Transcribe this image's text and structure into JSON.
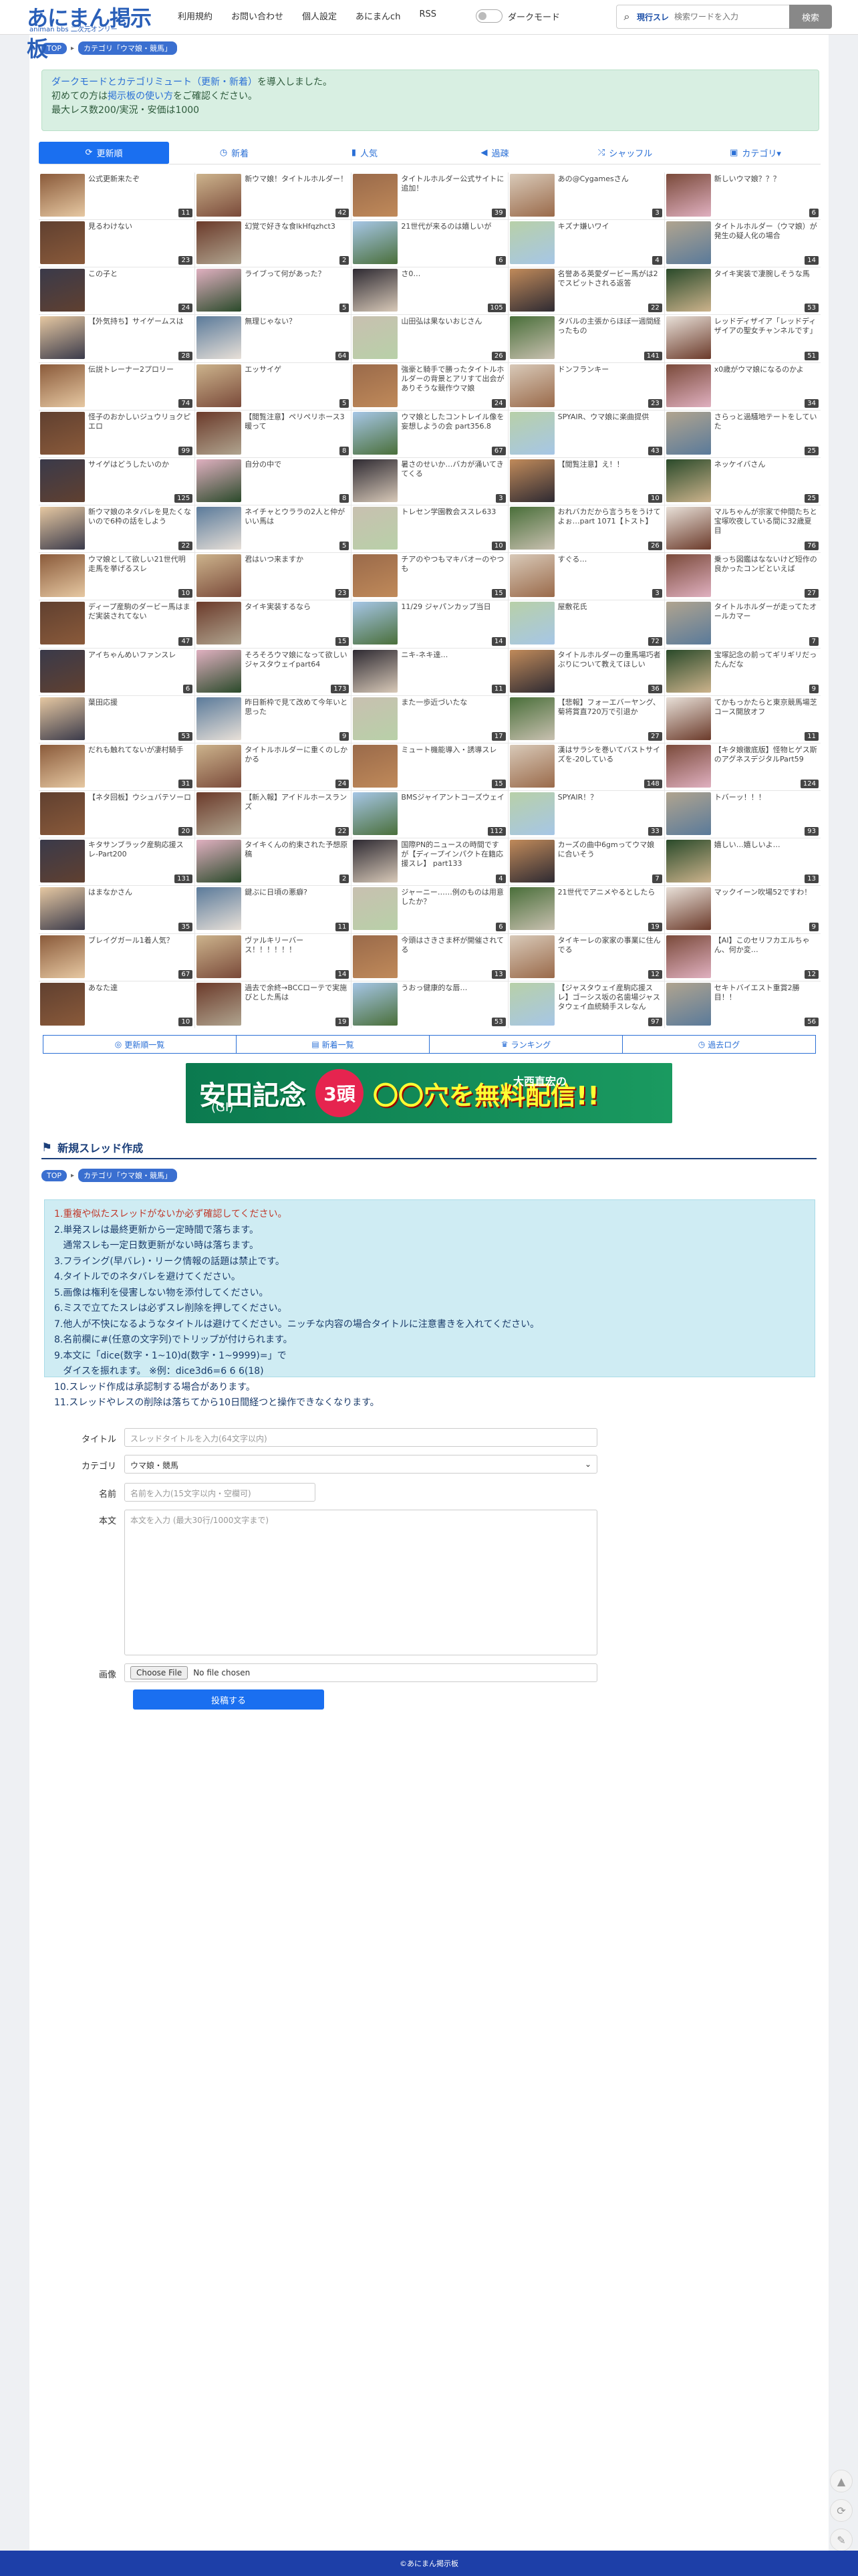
{
  "header": {
    "logo_main": "あにまん掲示板",
    "logo_sub": "animan bbs 二次元オンリー",
    "nav": [
      "利用規約",
      "お問い合わせ",
      "個人設定",
      "あにまんch",
      "RSS"
    ],
    "dark_mode_label": "ダークモード",
    "search_tag": "現行スレ",
    "search_placeholder": "検索ワードを入力",
    "search_button": "検索"
  },
  "breadcrumb": {
    "top": "TOP",
    "category": "カテゴリ「ウマ娘・競馬」"
  },
  "notice": {
    "line1_link": "ダークモードとカテゴリミュート（更新・新着）",
    "line1_text": "を導入しました。",
    "line2_pre": "初めての方は",
    "line2_link": "掲示板の使い方",
    "line2_post": "をご確認ください。",
    "line3": "最大レス数200/実況・安価は1000"
  },
  "tabs": [
    {
      "label": "更新順",
      "icon": "⟳"
    },
    {
      "label": "新着",
      "icon": "◷"
    },
    {
      "label": "人気",
      "icon": "▮"
    },
    {
      "label": "過疎",
      "icon": "◀"
    },
    {
      "label": "シャッフル",
      "icon": "⤮"
    },
    {
      "label": "カテゴリ▾",
      "icon": "▣"
    }
  ],
  "threads": [
    {
      "t": "公式更新来たぞ",
      "c": "11"
    },
    {
      "t": "新ウマ娘！タイトルホルダー！",
      "c": "42"
    },
    {
      "t": "タイトルホルダー公式サイトに追加！",
      "c": "39"
    },
    {
      "t": "あの@Cygamesさん",
      "c": "3"
    },
    {
      "t": "新しいウマ娘？？？",
      "c": "6"
    },
    {
      "t": "見るわけない",
      "c": "23"
    },
    {
      "t": "幻覚で好きな食lkHfqzhct3",
      "c": "2"
    },
    {
      "t": "21世代が来るのは嬉しいが",
      "c": "6"
    },
    {
      "t": "キズナ嫌いワイ",
      "c": "4"
    },
    {
      "t": "タイトルホルダー（ウマ娘）が発生の疑人化の場合",
      "c": "14"
    },
    {
      "t": "この子と",
      "c": "24"
    },
    {
      "t": "ライブって何があった？",
      "c": "5"
    },
    {
      "t": "さ0…",
      "c": "105"
    },
    {
      "t": "名誉ある英愛ダービー馬がは2でスピットされる返答",
      "c": "22"
    },
    {
      "t": "タイキ実装で凄腕しそうな馬",
      "c": "53"
    },
    {
      "t": "【外気持ち】サイゲームスは",
      "c": "28"
    },
    {
      "t": "無理じゃない？",
      "c": "64"
    },
    {
      "t": "山田弘は果ないおじさん",
      "c": "26"
    },
    {
      "t": "タバルの主張からほぼ一週間経ったもの",
      "c": "141"
    },
    {
      "t": "レッドディザイア「レッドディザイアの聖女チャンネルです」",
      "c": "51"
    },
    {
      "t": "伝説トレーナー2プロリー",
      "c": "74"
    },
    {
      "t": "エッサイゲ",
      "c": "5"
    },
    {
      "t": "強豪と騎手で勝ったタイトルホルダーの背景とアリすて出会がありそうな競作ウマ娘",
      "c": "24"
    },
    {
      "t": "ドンフランキー",
      "c": "23"
    },
    {
      "t": "x0歳がウマ娘になるのかよ",
      "c": "34"
    },
    {
      "t": "怪子のおかしいジュウリョクピエロ",
      "c": "99"
    },
    {
      "t": "【閲覧注意】ペリペリホース3暖って",
      "c": "8"
    },
    {
      "t": "ウマ娘としたコントレイル像を妄想しようの会 part356.8",
      "c": "67"
    },
    {
      "t": "SPYAIR、ウマ娘に楽曲提供",
      "c": "43"
    },
    {
      "t": "さらっと過騒地テートをしていた",
      "c": "25"
    },
    {
      "t": "サイゲはどうしたいのか",
      "c": "125"
    },
    {
      "t": "自分の中で",
      "c": "8"
    },
    {
      "t": "暑さのせいか…バカが涌いてきてくる",
      "c": "3"
    },
    {
      "t": "【閲覧注意】え！！",
      "c": "10"
    },
    {
      "t": "ネッケイバさん",
      "c": "25"
    },
    {
      "t": "新ウマ娘のネタバレを見たくないので6枠の話をしよう",
      "c": "22"
    },
    {
      "t": "ネイチャとウララの2人と仲がいい馬は",
      "c": "5"
    },
    {
      "t": "トレセン学園教会ススレ633",
      "c": "10"
    },
    {
      "t": "おれバカだから言うちをうけてよぉ…part 1071【トスト】",
      "c": "26"
    },
    {
      "t": "マルちゃんが宗家で仲間たちと宝塚吹夜している間に32歳夏目",
      "c": "76"
    },
    {
      "t": "ウマ娘として欲しい21世代明走馬を挙げるスレ",
      "c": "10"
    },
    {
      "t": "君はいつ来ますか",
      "c": "23"
    },
    {
      "t": "チアのやつもマキバオーのやつも",
      "c": "15"
    },
    {
      "t": "すぐる…",
      "c": "3"
    },
    {
      "t": "乗っち図鑑はなないけど短作の良かったコンビといえば",
      "c": "27"
    },
    {
      "t": "ディープ産駒のダービー馬はまだ実装されてない",
      "c": "47"
    },
    {
      "t": "タイキ実装するなら",
      "c": "15"
    },
    {
      "t": "11/29 ジャパンカップ当日",
      "c": "14"
    },
    {
      "t": "屋敷花氏",
      "c": "72"
    },
    {
      "t": "タイトルホルダーが走ってたオールカマー",
      "c": "7"
    },
    {
      "t": "アイちゃんめいファンスレ",
      "c": "6"
    },
    {
      "t": "そろそろウマ娘になって欲しいジャスタウェイpart64",
      "c": "173"
    },
    {
      "t": "ニキ-ネキ達…",
      "c": "11"
    },
    {
      "t": "タイトルホルダーの重馬場巧者ぶりについて教えてほしい",
      "c": "36"
    },
    {
      "t": "宝塚記念の前ってギリギリだったんだな",
      "c": "9"
    },
    {
      "t": "葉田応援",
      "c": "53"
    },
    {
      "t": "昨日新枠で見て改めて今年いと思った",
      "c": "9"
    },
    {
      "t": "また一歩近づいたな",
      "c": "17"
    },
    {
      "t": "【悲報】フォーエバーヤング、菊将賞直720万で引退か",
      "c": "27"
    },
    {
      "t": "てかもっかたらと東京競馬場芝コース開放オフ",
      "c": "11"
    },
    {
      "t": "だれも触れてないが凄村騎手",
      "c": "31"
    },
    {
      "t": "タイトルホルダーに重くのしかかる",
      "c": "24"
    },
    {
      "t": "ミュート機能導入・誘導スレ",
      "c": "15"
    },
    {
      "t": "漢はサラシを巻いてバストサイズを-20している",
      "c": "148"
    },
    {
      "t": "【キタ娘徹底版】怪物ヒゲス斯のアグネスデジタルPart59",
      "c": "124"
    },
    {
      "t": "【ネタ回板】ウシュバテソーロ",
      "c": "20"
    },
    {
      "t": "【新入報】アイドルホースランズ",
      "c": "22"
    },
    {
      "t": "BMSジャイアントコーズウェイ",
      "c": "112"
    },
    {
      "t": "SPYAIR！？",
      "c": "33"
    },
    {
      "t": "トバーッ！！！",
      "c": "93"
    },
    {
      "t": "キタサンブラック産駒応援スレ-Part200",
      "c": "131"
    },
    {
      "t": "タイキくんの約束された予想原稿",
      "c": "2"
    },
    {
      "t": "国際PN的ニュースの時間ですが【ディープインパクト在籍応援スレ】 part133",
      "c": "4"
    },
    {
      "t": "カーズの曲中6gmってウマ娘に合いそう",
      "c": "7"
    },
    {
      "t": "嬉しい…嬉しいよ…",
      "c": "13"
    },
    {
      "t": "はまなかさん",
      "c": "35"
    },
    {
      "t": "鍵ぶに日頃の悪癖?",
      "c": "11"
    },
    {
      "t": "ジャーニー……例のものは用意したか？",
      "c": "6"
    },
    {
      "t": "21世代でアニメやるとしたら",
      "c": "19"
    },
    {
      "t": "マックイーン吹場52ですわ！",
      "c": "9"
    },
    {
      "t": "ブレイグガール1着人気？",
      "c": "67"
    },
    {
      "t": "ヴァルキリーバー ス！！！！！！",
      "c": "14"
    },
    {
      "t": "今頭はさきさま杯が開催されてる",
      "c": "13"
    },
    {
      "t": "タイキーレの家家の事業に住んでる",
      "c": "12"
    },
    {
      "t": "【AI】このセリフカエルちゃん、何か変…",
      "c": "12"
    },
    {
      "t": "あなた達",
      "c": "10"
    },
    {
      "t": "過去で余終→BCCローテで実施びとした馬は",
      "c": "19"
    },
    {
      "t": "うおっ健康的な唇…",
      "c": "53"
    },
    {
      "t": "【ジャスタウェイ産駒応援スレ】ゴーシス坂の名歯場ジャスタウェイ血統騎手スレなん",
      "c": "97"
    },
    {
      "t": "セキトバイエスト重賞2勝目！！",
      "c": "56"
    }
  ],
  "thumb_colors": [
    "#8a5a3a",
    "#d8c9b8",
    "#6b3a2a",
    "#b0a48f",
    "#2e2a32",
    "#e6c8a2",
    "#4a6f3a",
    "#ccb38c",
    "#7a4a3a",
    "#a6c6e6",
    "#3a3a4a",
    "#c08a5a",
    "#5a7a9a",
    "#e8e0d8",
    "#9a6a4a",
    "#604030",
    "#b8d0a8",
    "#e0b0c0",
    "#2a4a2a",
    "#c8c0b0"
  ],
  "subnav": [
    {
      "label": "更新順一覧",
      "icon": "◎"
    },
    {
      "label": "新着一覧",
      "icon": "▤"
    },
    {
      "label": "ランキング",
      "icon": "♛"
    },
    {
      "label": "過去ログ",
      "icon": "◷"
    }
  ],
  "banner": {
    "title": "安田記念",
    "grade": "(GI)",
    "circle": "3頭",
    "offer": "〇〇穴を無料配信!!",
    "maker": "大西直宏の"
  },
  "form": {
    "heading": "新規スレッド作成",
    "rules": [
      "1.重複や似たスレッドがないか必ず確認してください。",
      "2.単発スレは最終更新から一定時間で落ちます。",
      "   通常スレも一定日数更新がない時は落ちます。",
      "3.フライング(早バレ)・リーク情報の話題は禁止です。",
      "4.タイトルでのネタバレを避けてください。",
      "5.画像は権利を侵害しない物を添付してください。",
      "6.ミスで立てたスレは必ずスレ削除を押してください。",
      "7.他人が不快になるようなタイトルは避けてください。ニッチな内容の場合タイトルに注意書きを入れてください。",
      "8.名前欄に#(任意の文字列)でトリップが付けられます。",
      "9.本文に「dice(数字・1~10)d(数字・1~9999)=」で",
      "   ダイスを振れます。 ※例：dice3d6=6 6 6(18)",
      "10.スレッド作成は承認制する場合があります。",
      "11.スレッドやレスの削除は落ちてから10日間経つと操作できなくなります。"
    ],
    "title_label": "タイトル",
    "title_placeholder": "スレッドタイトルを入力(64文字以内)",
    "category_label": "カテゴリ",
    "category_value": "ウマ娘・競馬",
    "name_label": "名前",
    "name_placeholder": "名前を入力(15文字以内・空欄可)",
    "body_label": "本文",
    "body_placeholder": "本文を入力 (最大30行/1000文字まで)",
    "image_label": "画像",
    "file_button": "Choose File",
    "file_status": "No file chosen",
    "submit": "投稿する"
  },
  "footer": "©あにまん掲示板"
}
